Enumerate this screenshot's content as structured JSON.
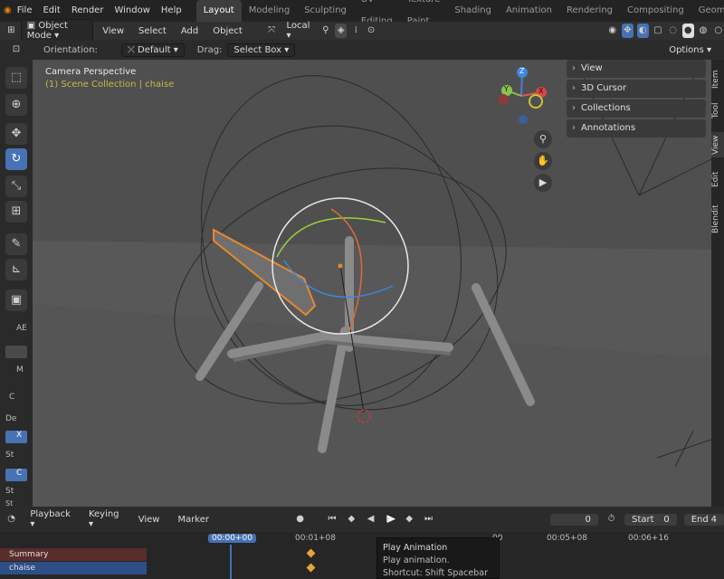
{
  "topbar": {
    "menus": [
      "File",
      "Edit",
      "Render",
      "Window",
      "Help"
    ],
    "workspaces": [
      "Layout",
      "Modeling",
      "Sculpting",
      "UV Editing",
      "Texture Paint",
      "Shading",
      "Animation",
      "Rendering",
      "Compositing",
      "Geome"
    ],
    "active_workspace": "Layout"
  },
  "header": {
    "mode": "Object Mode",
    "menus": [
      "View",
      "Select",
      "Add",
      "Object"
    ],
    "transform_space": "Local"
  },
  "tool_settings": {
    "orientation_label": "Orientation:",
    "orientation_value": "Default",
    "drag_label": "Drag:",
    "drag_value": "Select Box",
    "options": "Options"
  },
  "viewport": {
    "camera_label": "Camera Perspective",
    "collection_label": "(1) Scene Collection | chaise",
    "gizmo_axes": [
      "Z",
      "Y",
      "X"
    ]
  },
  "npanel": {
    "items": [
      "View",
      "3D Cursor",
      "Collections",
      "Annotations"
    ],
    "tabs": [
      "Item",
      "Tool",
      "View",
      "Edit",
      "Blendit"
    ]
  },
  "left_panel": {
    "labels": [
      "AE",
      "M",
      "C",
      "De",
      "X",
      "St",
      "C",
      "St",
      "St"
    ]
  },
  "timeline": {
    "menus": [
      "Playback",
      "Keying",
      "View",
      "Marker"
    ],
    "current_frame": "0",
    "start_label": "Start",
    "start_value": "0",
    "end_label": "End",
    "end_value": "4",
    "time_markers": [
      "00:00+00",
      "00:01+08",
      "00",
      "00:05+08",
      "00:06+16"
    ],
    "channels": [
      "Summary",
      "chaise"
    ]
  },
  "tooltip": {
    "title": "Play Animation",
    "description": "Play animation.",
    "shortcut": "Shortcut: Shift Spacebar"
  },
  "colors": {
    "accent": "#4772b3",
    "selection_outline": "#e8892c",
    "collection_text": "#c6b94a"
  }
}
